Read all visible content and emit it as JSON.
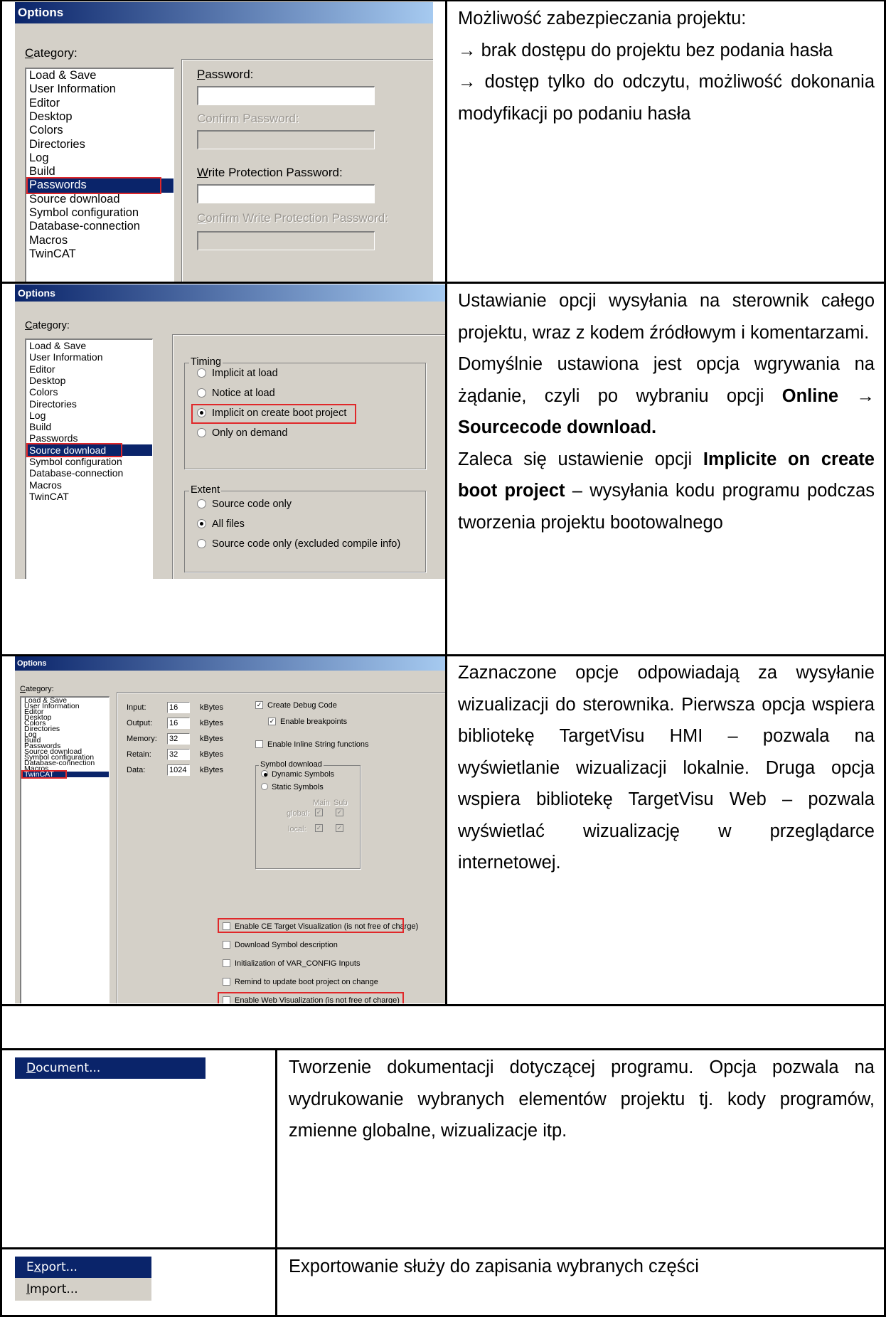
{
  "section1": {
    "dialog": {
      "title": "Options",
      "category_label": "Category:",
      "categories": [
        "Load & Save",
        "User Information",
        "Editor",
        "Desktop",
        "Colors",
        "Directories",
        "Log",
        "Build",
        "Passwords",
        "Source download",
        "Symbol configuration",
        "Database-connection",
        "Macros",
        "TwinCAT"
      ],
      "selected_category": "Passwords",
      "password_label": "Password:",
      "confirm_password_label": "Confirm Password:",
      "write_protection_label": "Write Protection Password:",
      "confirm_write_protection_label": "Confirm Write Protection Password:"
    },
    "description": {
      "line1": "Możliwość zabezpieczania projektu:",
      "item1": "→  brak dostępu do projektu bez podania hasła",
      "item2": "→ dostęp tylko do odczytu, możliwość dokonania modyfikacji po podaniu hasła"
    }
  },
  "section2": {
    "dialog": {
      "title": "Options",
      "category_label": "Category:",
      "categories": [
        "Load & Save",
        "User Information",
        "Editor",
        "Desktop",
        "Colors",
        "Directories",
        "Log",
        "Build",
        "Passwords",
        "Source download",
        "Symbol configuration",
        "Database-connection",
        "Macros",
        "TwinCAT"
      ],
      "selected_category": "Source download",
      "timing_title": "Timing",
      "timing_options": [
        "Implicit at load",
        "Notice at load",
        "Implicit on create boot project",
        "Only on demand"
      ],
      "timing_selected": "Implicit on create boot project",
      "extent_title": "Extent",
      "extent_options": [
        "Source code only",
        "All files",
        "Source code only (excluded compile info)"
      ],
      "extent_selected": "All files"
    },
    "description": {
      "p1": "Ustawianie opcji wysyłania na sterownik całego projektu, wraz z kodem źródłowym i komentarzami.",
      "p2_a": "Domyślnie ustawiona jest opcja wgrywania na żądanie, czyli po wybraniu opcji ",
      "p2_b": "Online → Sourcecode download.",
      "p3_a": "Zaleca się ustawienie opcji ",
      "p3_b": "Implicite on create boot project",
      "p3_c": " – wysyłania kodu programu podczas tworzenia projektu bootowalnego"
    }
  },
  "section3": {
    "dialog": {
      "title": "Options",
      "category_label": "Category:",
      "categories": [
        "Load & Save",
        "User Information",
        "Editor",
        "Desktop",
        "Colors",
        "Directories",
        "Log",
        "Build",
        "Passwords",
        "Source download",
        "Symbol configuration",
        "Database-connection",
        "Macros",
        "TwinCAT"
      ],
      "selected_category": "TwinCAT",
      "memory_fields": [
        {
          "label": "Input:",
          "value": "16",
          "unit": "kBytes"
        },
        {
          "label": "Output:",
          "value": "16",
          "unit": "kBytes"
        },
        {
          "label": "Memory:",
          "value": "32",
          "unit": "kBytes"
        },
        {
          "label": "Retain:",
          "value": "32",
          "unit": "kBytes"
        },
        {
          "label": "Data:",
          "value": "1024",
          "unit": "kBytes"
        }
      ],
      "create_debug_code": "Create Debug Code",
      "enable_breakpoints": "Enable breakpoints",
      "enable_inline": "Enable Inline String functions",
      "symbol_download_title": "Symbol download",
      "dynamic_symbols": "Dynamic Symbols",
      "static_symbols": "Static Symbols",
      "col_main": "Main",
      "col_sub": "Sub",
      "row_global": "global:",
      "row_local": "local:",
      "enable_ce": "Enable CE Target Visualization (is not free of charge)",
      "download_symbol": "Download Symbol description",
      "init_var_config": "Initialization of VAR_CONFIG Inputs",
      "remind_update": "Remind to update boot project on change",
      "enable_web": "Enable Web Visualization (is not free of charge)"
    },
    "description": "Zaznaczone opcje odpowiadają za wysyłanie wizualizacji do sterownika. Pierwsza opcja wspiera bibliotekę TargetVisu HMI – pozwala na wyświetlanie wizualizacji lokalnie. Druga opcja wspiera bibliotekę TargetVisu Web – pozwala wyświetlać wizualizację w przeglądarce internetowej."
  },
  "section4": {
    "menu_document": "Document...",
    "description": "Tworzenie dokumentacji dotyczącej programu. Opcja pozwala na wydrukowanie wybranych elementów projektu tj. kody programów, zmienne globalne, wizualizacje itp."
  },
  "section5": {
    "menu_export": "Export...",
    "menu_import": "Import...",
    "description": "Exportowanie służy do zapisania wybranych części"
  }
}
